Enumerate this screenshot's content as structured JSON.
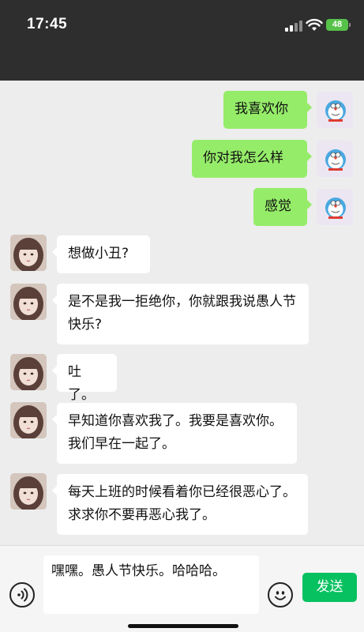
{
  "status": {
    "time": "17:45",
    "battery": "48"
  },
  "messages": [
    {
      "side": "me",
      "text": "我喜欢你"
    },
    {
      "side": "me",
      "text": "你对我怎么样"
    },
    {
      "side": "me",
      "text": "感觉"
    },
    {
      "side": "them",
      "text": "想做小丑?"
    },
    {
      "side": "them",
      "text": "是不是我一拒绝你，你就跟我说愚人节快乐?"
    },
    {
      "side": "them",
      "text": "吐了。"
    },
    {
      "side": "them",
      "text": "早知道你喜欢我了。我要是喜欢你。我们早在一起了。"
    },
    {
      "side": "them",
      "text": "每天上班的时候看着你已经很恶心了。求求你不要再恶心我了。"
    }
  ],
  "composer": {
    "draft": "嘿嘿。愚人节快乐。哈哈哈。",
    "send_label": "发送"
  },
  "colors": {
    "my_bubble": "#95ec69",
    "their_bubble": "#ffffff",
    "send_button": "#07c160"
  }
}
